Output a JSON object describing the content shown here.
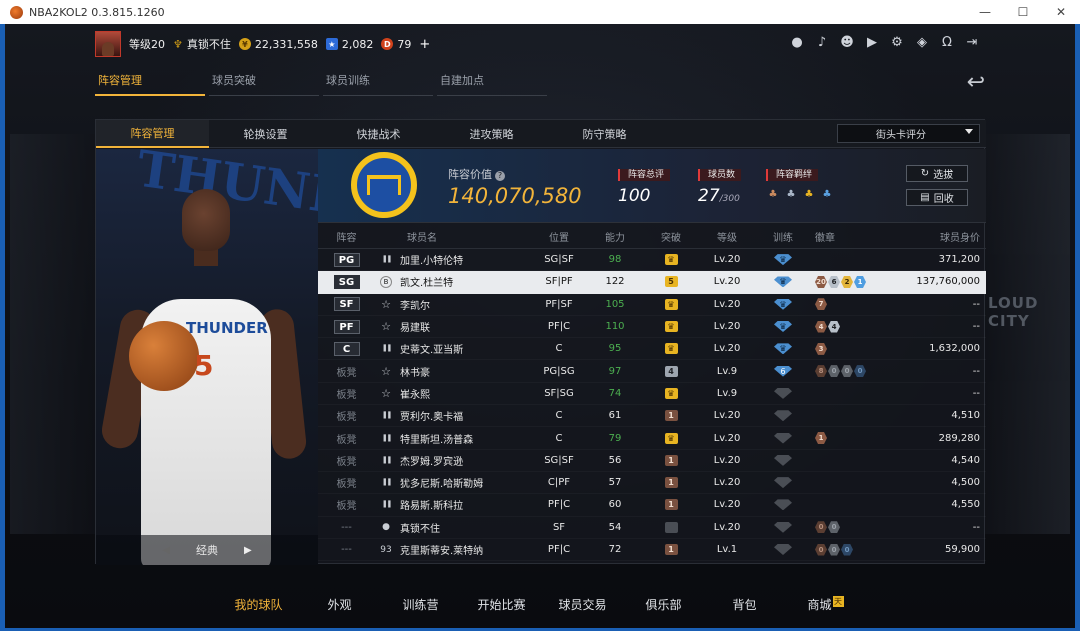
{
  "window": {
    "title": "NBA2KOL2 0.3.815.1260",
    "minimize": "—",
    "maximize": "☐",
    "close": "✕"
  },
  "user": {
    "level": "等级20",
    "name": "真锁不住",
    "gold": "22,331,558",
    "gems": "2,082",
    "points": "79",
    "plus": "+"
  },
  "top_icons": [
    "person-icon",
    "bell-icon",
    "friends-icon",
    "video-icon",
    "gear-icon",
    "shield-icon",
    "headset-icon",
    "exit-icon"
  ],
  "main_tabs": [
    {
      "label": "阵容管理",
      "active": true
    },
    {
      "label": "球员突破",
      "active": false
    },
    {
      "label": "球员训练",
      "active": false
    },
    {
      "label": "自建加点",
      "active": false
    }
  ],
  "sub_tabs": [
    {
      "label": "阵容管理",
      "active": true
    },
    {
      "label": "轮换设置",
      "active": false
    },
    {
      "label": "快捷战术",
      "active": false
    },
    {
      "label": "进攻策略",
      "active": false
    },
    {
      "label": "防守策略",
      "active": false
    }
  ],
  "sort_select": {
    "value": "街头卡评分"
  },
  "player_card": {
    "team_text": "THUNDER",
    "jersey_text": "THUNDER",
    "number": "5",
    "style_label": "经典"
  },
  "arena_sign": "LOUD CITY",
  "summary": {
    "value_label": "阵容价值",
    "value_help": "?",
    "value": "140,070,580",
    "rating_label": "阵容总评",
    "rating": "100",
    "count_label": "球员数",
    "count": "27",
    "count_max": "/300",
    "chem_label": "阵容羁绊",
    "btn_select": "选拔",
    "btn_recycle": "回收"
  },
  "table": {
    "headers": {
      "slot": "阵容",
      "name": "球员名",
      "pos": "位置",
      "ability": "能力",
      "breakthrough": "突破",
      "level": "等级",
      "training": "训练",
      "badges": "徽章",
      "salary": "球员身价"
    },
    "rows": [
      {
        "slot": "PG",
        "bench": false,
        "icon": "bars",
        "name": "加里.小特伦特",
        "pos": "SG|SF",
        "ability": "98",
        "green": true,
        "brk": "crown",
        "brk_text": "",
        "level": "Lv.20",
        "trn": "blue",
        "trn_text": "",
        "badges": [],
        "salary": "371,200",
        "hl": false
      },
      {
        "slot": "SG",
        "bench": false,
        "icon": "circle",
        "icon_text": "B",
        "name": "凯文.杜兰特",
        "pos": "SF|PF",
        "ability": "122",
        "green": false,
        "brk": "num-gold",
        "brk_text": "5",
        "level": "Lv.20",
        "trn": "blue",
        "trn_text": "",
        "badges": [
          {
            "c": "br",
            "t": "20"
          },
          {
            "c": "si",
            "t": "6"
          },
          {
            "c": "go",
            "t": "2"
          },
          {
            "c": "bl",
            "t": "1"
          }
        ],
        "salary": "137,760,000",
        "hl": true
      },
      {
        "slot": "SF",
        "bench": false,
        "icon": "star",
        "name": "李凯尔",
        "pos": "PF|SF",
        "ability": "105",
        "green": true,
        "brk": "crown",
        "brk_text": "",
        "level": "Lv.20",
        "trn": "blue",
        "trn_text": "",
        "badges": [
          {
            "c": "br",
            "t": "7"
          }
        ],
        "salary": "--",
        "hl": false
      },
      {
        "slot": "PF",
        "bench": false,
        "icon": "star",
        "name": "易建联",
        "pos": "PF|C",
        "ability": "110",
        "green": true,
        "brk": "crown",
        "brk_text": "",
        "level": "Lv.20",
        "trn": "blue",
        "trn_text": "",
        "badges": [
          {
            "c": "br",
            "t": "4"
          },
          {
            "c": "si",
            "t": "4"
          }
        ],
        "salary": "--",
        "hl": false
      },
      {
        "slot": "C",
        "bench": false,
        "icon": "bars",
        "name": "史蒂文.亚当斯",
        "pos": "C",
        "ability": "95",
        "green": true,
        "brk": "crown",
        "brk_text": "",
        "level": "Lv.20",
        "trn": "blue",
        "trn_text": "",
        "badges": [
          {
            "c": "br",
            "t": "3"
          }
        ],
        "salary": "1,632,000",
        "hl": false
      },
      {
        "slot": "板凳",
        "bench": true,
        "icon": "star",
        "name": "林书豪",
        "pos": "PG|SG",
        "ability": "97",
        "green": true,
        "brk": "num-silver",
        "brk_text": "4",
        "level": "Lv.9",
        "trn": "blue-num",
        "trn_text": "6",
        "badges": [
          {
            "c": "bdim",
            "t": "8"
          },
          {
            "c": "sdim",
            "t": "0"
          },
          {
            "c": "sdim",
            "t": "0"
          },
          {
            "c": "bldim",
            "t": "0"
          }
        ],
        "salary": "--",
        "hl": false
      },
      {
        "slot": "板凳",
        "bench": true,
        "icon": "star",
        "name": "崔永熙",
        "pos": "SF|SG",
        "ability": "74",
        "green": true,
        "brk": "crown",
        "brk_text": "",
        "level": "Lv.9",
        "trn": "gray",
        "trn_text": "",
        "badges": [],
        "salary": "--",
        "hl": false
      },
      {
        "slot": "板凳",
        "bench": true,
        "icon": "bars",
        "name": "贾利尔.奥卡福",
        "pos": "C",
        "ability": "61",
        "green": false,
        "brk": "num-brown",
        "brk_text": "1",
        "level": "Lv.20",
        "trn": "gray",
        "trn_text": "",
        "badges": [],
        "salary": "4,510",
        "hl": false
      },
      {
        "slot": "板凳",
        "bench": true,
        "icon": "bars",
        "name": "特里斯坦.汤普森",
        "pos": "C",
        "ability": "79",
        "green": true,
        "brk": "crown",
        "brk_text": "",
        "level": "Lv.20",
        "trn": "gray",
        "trn_text": "",
        "badges": [
          {
            "c": "br",
            "t": "1"
          }
        ],
        "salary": "289,280",
        "hl": false
      },
      {
        "slot": "板凳",
        "bench": true,
        "icon": "bars",
        "name": "杰罗姆.罗宾逊",
        "pos": "SG|SF",
        "ability": "56",
        "green": false,
        "brk": "num-brown",
        "brk_text": "1",
        "level": "Lv.20",
        "trn": "gray",
        "trn_text": "",
        "badges": [],
        "salary": "4,540",
        "hl": false
      },
      {
        "slot": "板凳",
        "bench": true,
        "icon": "bars",
        "name": "犹多尼斯.哈斯勒姆",
        "pos": "C|PF",
        "ability": "57",
        "green": false,
        "brk": "num-brown",
        "brk_text": "1",
        "level": "Lv.20",
        "trn": "gray",
        "trn_text": "",
        "badges": [],
        "salary": "4,500",
        "hl": false
      },
      {
        "slot": "板凳",
        "bench": true,
        "icon": "bars",
        "name": "路易斯.斯科拉",
        "pos": "PF|C",
        "ability": "60",
        "green": false,
        "brk": "num-brown",
        "brk_text": "1",
        "level": "Lv.20",
        "trn": "gray",
        "trn_text": "",
        "badges": [],
        "salary": "4,550",
        "hl": false
      },
      {
        "slot": "---",
        "bench": true,
        "icon": "person",
        "name": "真锁不住",
        "pos": "SF",
        "ability": "54",
        "green": false,
        "brk": "none",
        "brk_text": "",
        "level": "Lv.20",
        "trn": "gray",
        "trn_text": "",
        "badges": [
          {
            "c": "bdim",
            "t": "0"
          },
          {
            "c": "sdim",
            "t": "0"
          }
        ],
        "salary": "--",
        "hl": false
      },
      {
        "slot": "---",
        "bench": true,
        "icon": "num",
        "icon_text": "93",
        "name": "克里斯蒂安.莱特纳",
        "pos": "PF|C",
        "ability": "72",
        "green": false,
        "brk": "num-brown",
        "brk_text": "1",
        "level": "Lv.1",
        "trn": "gray",
        "trn_text": "",
        "badges": [
          {
            "c": "bdim",
            "t": "0"
          },
          {
            "c": "sdim",
            "t": "0"
          },
          {
            "c": "bldim",
            "t": "0"
          }
        ],
        "salary": "59,900",
        "hl": false
      }
    ]
  },
  "bottom_nav": [
    {
      "label": "我的球队",
      "active": true
    },
    {
      "label": "外观",
      "active": false
    },
    {
      "label": "训练营",
      "active": false
    },
    {
      "label": "开始比赛",
      "active": false
    },
    {
      "label": "球员交易",
      "active": false
    },
    {
      "label": "俱乐部",
      "active": false
    },
    {
      "label": "背包",
      "active": false
    },
    {
      "label": "商城",
      "active": false,
      "mini": "天"
    }
  ]
}
